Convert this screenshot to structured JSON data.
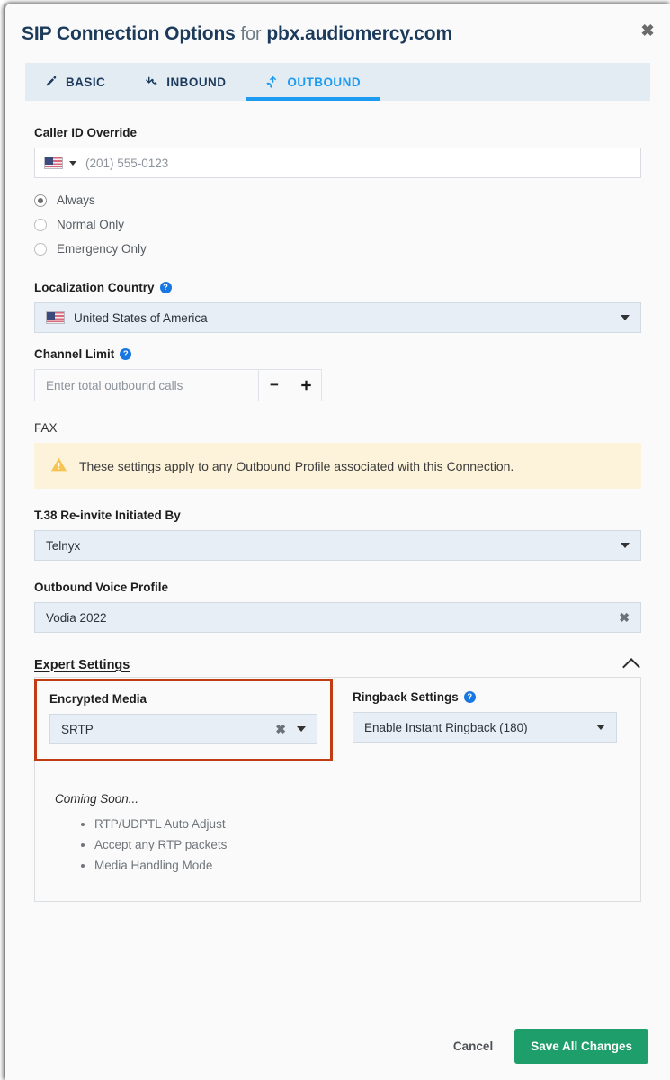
{
  "dialog": {
    "title_main": "SIP Connection Options",
    "title_for": "for",
    "title_host": "pbx.audiomercy.com",
    "close_label": "✖"
  },
  "tabs": [
    {
      "label": "BASIC",
      "icon": "pencil-icon",
      "active": false
    },
    {
      "label": "INBOUND",
      "icon": "inbound-arrow-icon",
      "active": false
    },
    {
      "label": "OUTBOUND",
      "icon": "outbound-arrow-icon",
      "active": true
    }
  ],
  "caller_id": {
    "label": "Caller ID Override",
    "country_flag": "us-flag-icon",
    "phone_placeholder": "(201) 555-0123",
    "phone_value": "",
    "options": [
      {
        "label": "Always",
        "selected": true
      },
      {
        "label": "Normal Only",
        "selected": false
      },
      {
        "label": "Emergency Only",
        "selected": false
      }
    ]
  },
  "localization": {
    "label": "Localization Country",
    "help": "?",
    "value": "United States of America",
    "flag": "us-flag-icon"
  },
  "channel_limit": {
    "label": "Channel Limit",
    "help": "?",
    "placeholder": "Enter total outbound calls",
    "value": "",
    "minus": "−",
    "plus": "＋"
  },
  "fax": {
    "label": "FAX",
    "warning": "These settings apply to any Outbound Profile associated with this Connection.",
    "warning_icon": "warning-triangle-icon",
    "t38_label": "T.38 Re-invite Initiated By",
    "t38_value": "Telnyx"
  },
  "voice_profile": {
    "label": "Outbound Voice Profile",
    "value": "Vodia 2022",
    "clear": "✖"
  },
  "expert": {
    "title": "Expert Settings",
    "expanded": true,
    "encrypted_media": {
      "label": "Encrypted Media",
      "value": "SRTP",
      "clear": "✖",
      "highlight_color": "#bf3d10"
    },
    "ringback": {
      "label": "Ringback Settings",
      "help": "?",
      "value": "Enable Instant Ringback (180)"
    },
    "coming_soon_label": "Coming Soon...",
    "coming_soon_items": [
      "RTP/UDPTL Auto Adjust",
      "Accept any RTP packets",
      "Media Handling Mode"
    ]
  },
  "footer": {
    "cancel_label": "Cancel",
    "save_label": "Save All Changes",
    "save_color": "#1d9e6b"
  }
}
